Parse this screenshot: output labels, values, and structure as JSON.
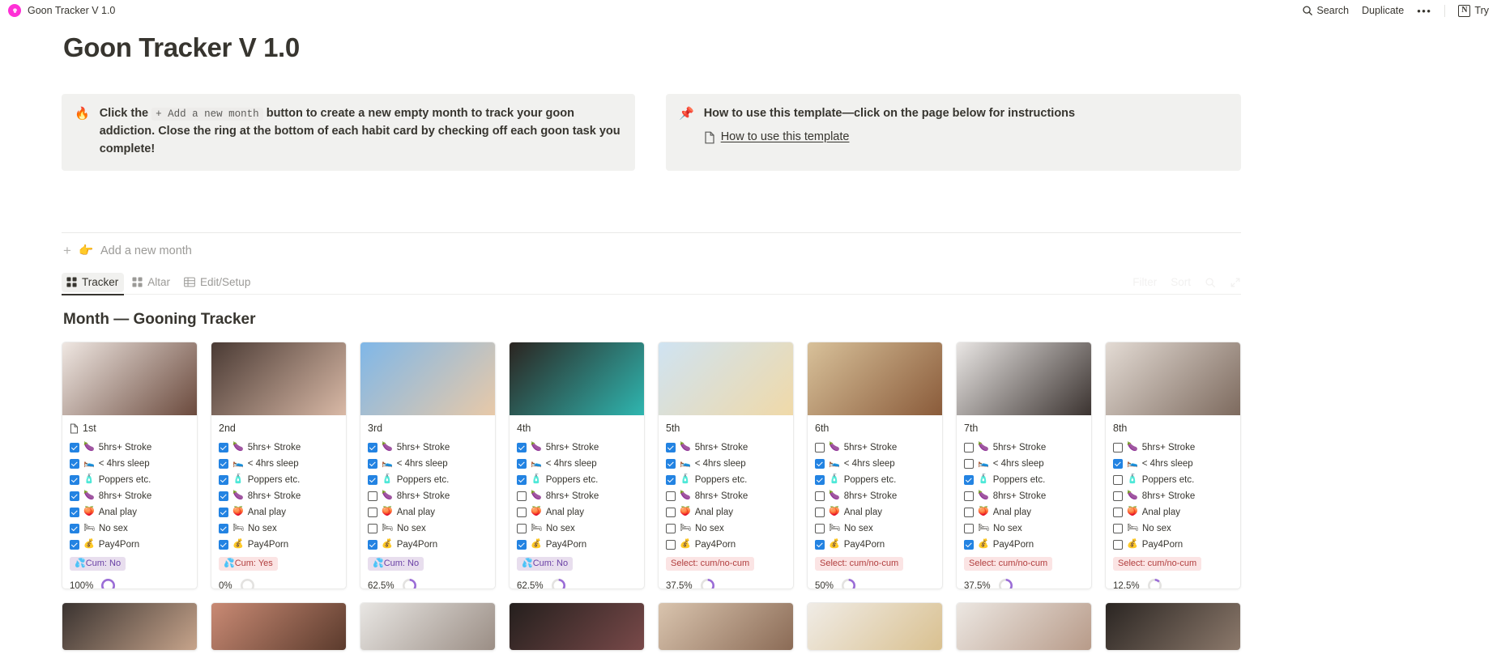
{
  "topbar": {
    "page_name": "Goon Tracker V 1.0",
    "brand_icon": "pink-brain-icon",
    "search_label": "Search",
    "search_icon": "search-icon",
    "duplicate_label": "Duplicate",
    "more_label": "•••",
    "notion_logo_letter": "N",
    "try_label": "Try"
  },
  "page": {
    "title": "Goon Tracker V 1.0"
  },
  "callouts": [
    {
      "emoji": "🔥",
      "emoji_name": "fire-emoji",
      "text_before": "Click the",
      "chip": "+ Add a new month",
      "text_after": "button to create a new empty month to track your goon addiction. Close the ring at the bottom of each habit card by checking off each goon task you complete!"
    },
    {
      "emoji": "📌",
      "emoji_name": "pushpin-emoji",
      "text": "How to use this template—click on the page below for instructions",
      "link_icon": "page-icon",
      "link_text": "How to use this template"
    }
  ],
  "add_month": {
    "plus": "+",
    "emoji": "👉",
    "label": "Add a new month"
  },
  "tabs": [
    {
      "label": "Tracker",
      "icon": "gallery-view-icon",
      "active": true
    },
    {
      "label": "Altar",
      "icon": "gallery-view-icon",
      "active": false
    },
    {
      "label": "Edit/Setup",
      "icon": "table-view-icon",
      "active": false
    }
  ],
  "tabs_right": {
    "filter_label": "Filter",
    "sort_label": "Sort",
    "search_icon": "search-icon",
    "expand_icon": "expand-icon"
  },
  "gallery": {
    "title": "Month — Gooning Tracker",
    "property_icons": {
      "stroke5": "🍆",
      "sleep": "🛌",
      "poppers": "🧴",
      "stroke8": "🍆",
      "anal": "🍑",
      "nosex": "🛏",
      "pay": "💰",
      "cum": "💦"
    },
    "property_labels": [
      "5hrs+ Stroke",
      "< 4hrs sleep",
      "Poppers etc.",
      "8hrs+ Stroke",
      "Anal play",
      "No sex",
      "Pay4Porn"
    ],
    "accent_ring": "#9b6dd7",
    "ring_empty": "#e3e2e0",
    "checkbox_on": "#2383e2",
    "cards": [
      {
        "title": "1st",
        "has_page_icon": true,
        "img_from": "#efe7e2",
        "img_to": "#6b4a3d",
        "checks": [
          true,
          true,
          true,
          true,
          true,
          true,
          true
        ],
        "badge": "💦Cum: No",
        "badge_style": "purple",
        "percent": "100%",
        "percent_value": 100
      },
      {
        "title": "2nd",
        "has_page_icon": false,
        "img_from": "#4a3a34",
        "img_to": "#d9b9a6",
        "checks": [
          true,
          true,
          true,
          true,
          true,
          true,
          true
        ],
        "badge": "💦Cum: Yes",
        "badge_style": "pink",
        "percent": "0%",
        "percent_value": 0
      },
      {
        "title": "3rd",
        "has_page_icon": false,
        "img_from": "#7fb7e8",
        "img_to": "#e8c9a8",
        "checks": [
          true,
          true,
          true,
          false,
          false,
          false,
          true
        ],
        "badge": "💦Cum: No",
        "badge_style": "purple",
        "percent": "62.5%",
        "percent_value": 62.5
      },
      {
        "title": "4th",
        "has_page_icon": false,
        "img_from": "#2b2420",
        "img_to": "#2fb6b0",
        "checks": [
          true,
          true,
          true,
          false,
          false,
          false,
          true
        ],
        "badge": "💦Cum: No",
        "badge_style": "purple",
        "percent": "62.5%",
        "percent_value": 62.5
      },
      {
        "title": "5th",
        "has_page_icon": false,
        "img_from": "#cfe3f2",
        "img_to": "#f0d9a8",
        "checks": [
          true,
          true,
          true,
          false,
          false,
          false,
          false
        ],
        "badge": "Select: cum/no-cum",
        "badge_style": "pink",
        "percent": "37.5%",
        "percent_value": 37.5
      },
      {
        "title": "6th",
        "has_page_icon": false,
        "img_from": "#d8c19a",
        "img_to": "#8a5b3a",
        "checks": [
          false,
          true,
          true,
          false,
          false,
          false,
          true
        ],
        "badge": "Select: cum/no-cum",
        "badge_style": "pink",
        "percent": "50%",
        "percent_value": 50
      },
      {
        "title": "7th",
        "has_page_icon": false,
        "img_from": "#e9e6e4",
        "img_to": "#3b3330",
        "checks": [
          false,
          false,
          true,
          false,
          false,
          false,
          true
        ],
        "badge": "Select: cum/no-cum",
        "badge_style": "pink",
        "percent": "37.5%",
        "percent_value": 37.5
      },
      {
        "title": "8th",
        "has_page_icon": false,
        "img_from": "#e3dbd4",
        "img_to": "#7d6a5e",
        "checks": [
          false,
          true,
          false,
          false,
          false,
          false,
          false
        ],
        "badge": "Select: cum/no-cum",
        "badge_style": "pink",
        "percent": "12.5%",
        "percent_value": 12.5
      }
    ],
    "cards_row2": [
      {
        "img_from": "#3a3330",
        "img_to": "#c8a58c"
      },
      {
        "img_from": "#c98a74",
        "img_to": "#5a3a2c"
      },
      {
        "img_from": "#e8e6e3",
        "img_to": "#9a8d84"
      },
      {
        "img_from": "#241f1d",
        "img_to": "#7a4a4a"
      },
      {
        "img_from": "#d9c4ae",
        "img_to": "#8a6a55"
      },
      {
        "img_from": "#f0ece6",
        "img_to": "#d9c08f"
      },
      {
        "img_from": "#ece7e2",
        "img_to": "#b79a88"
      },
      {
        "img_from": "#2a2522",
        "img_to": "#8d7a6c"
      }
    ]
  }
}
